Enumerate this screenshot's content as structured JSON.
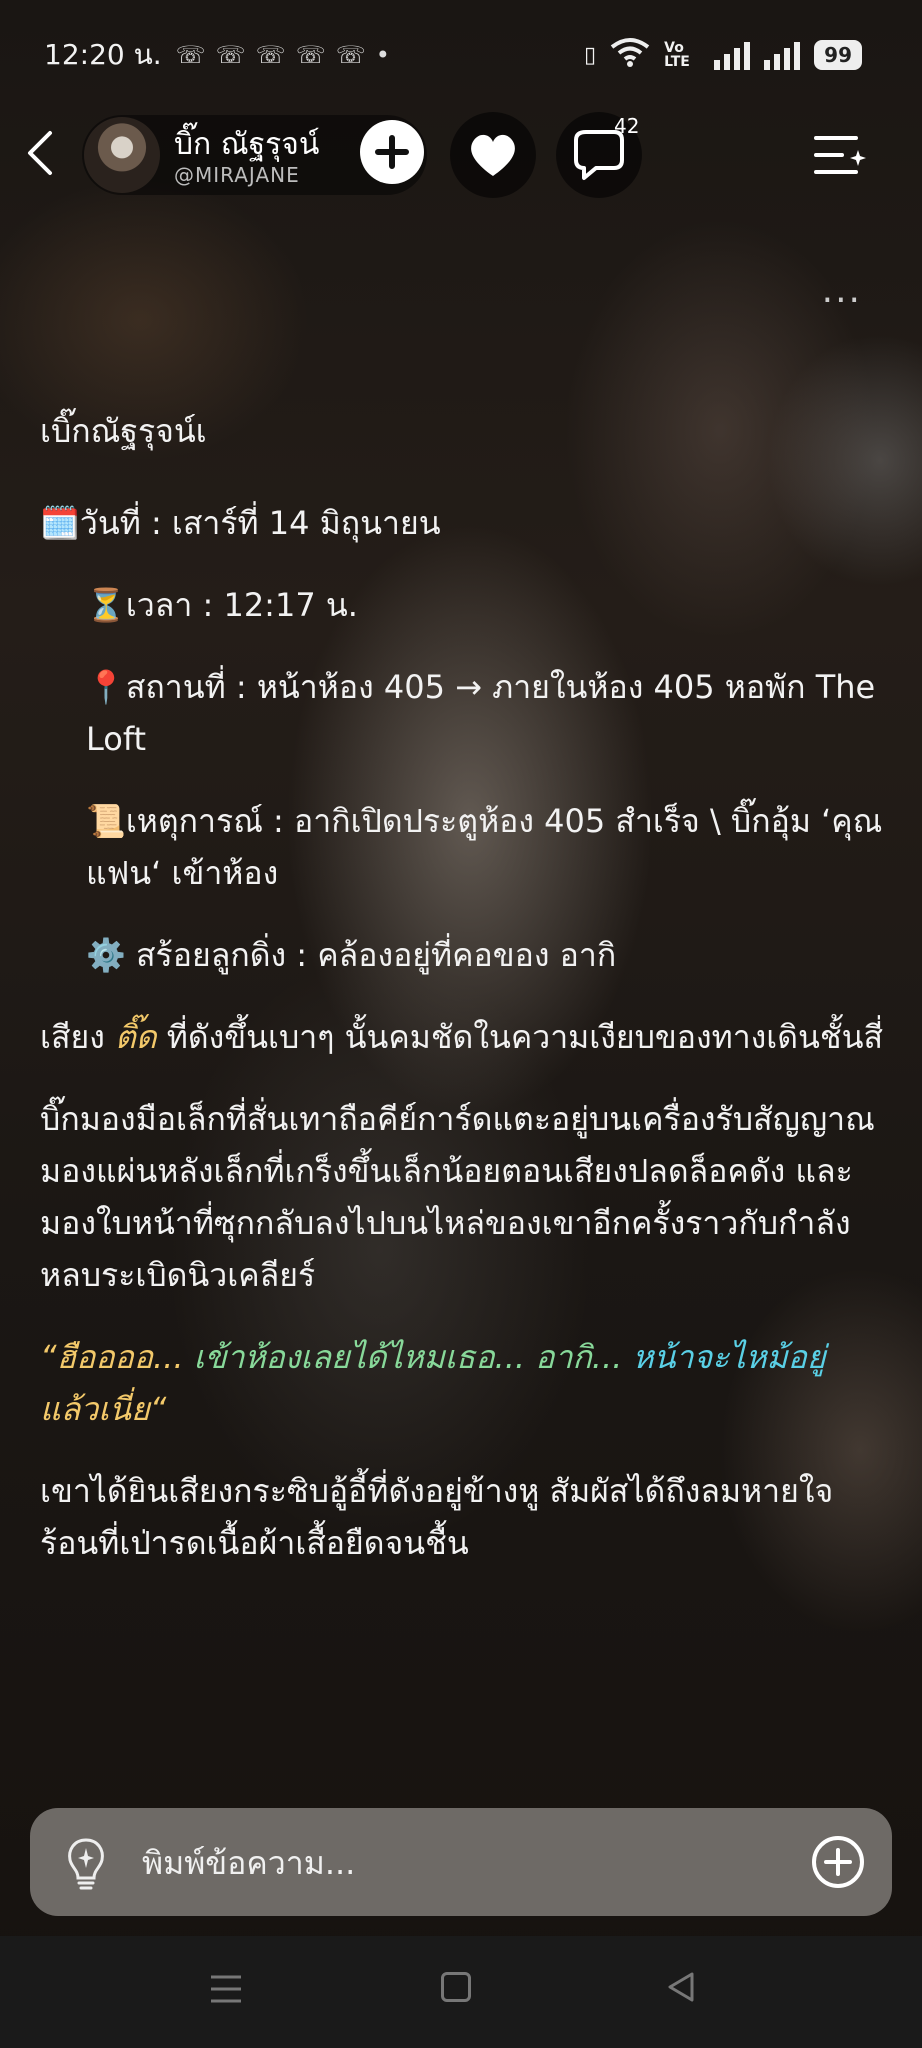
{
  "status_bar": {
    "time": "12:20 น.",
    "notification_icons": [
      "whatsapp-icon",
      "whatsapp-icon",
      "whatsapp-icon",
      "whatsapp-icon",
      "whatsapp-icon"
    ],
    "network_label": "Vo LTE",
    "battery": "99"
  },
  "header": {
    "profile_name": "บิ๊ก ณัฐรุจน์",
    "handle": "@MIRAJANE",
    "comment_count": "42"
  },
  "more_label": "...",
  "content": {
    "title": "เบิ๊กณัฐรุจน์เ",
    "date_emoji": "🗓️",
    "date_text": "วันที่ : เสาร์ที่ 14 มิถุนายน",
    "time_emoji": "⏳",
    "time_text": "เวลา : 12:17 น.",
    "place_emoji": "📍",
    "place_text": "สถานที่ : หน้าห้อง 405 → ภายในห้อง 405 หอพัก The Loft",
    "event_emoji": "📜",
    "event_text": "เหตุการณ์ : อากิเปิดประตูห้อง 405 สำเร็จ \\ บิ๊กอุ้ม ‘คุณแฟน‘ เข้าห้อง",
    "necklace_emoji": "⚙️",
    "necklace_text": "สร้อยลูกดิ่ง : คล้องอยู่ที่คอของ อากิ",
    "para1_a": "เสียง ",
    "para1_highlight": "ติ๊ด",
    "para1_b": " ที่ดังขึ้นเบาๆ นั้นคมชัดในความเงียบของทางเดินชั้นสี่",
    "para2": "บิ๊กมองมือเล็กที่สั่นเทาถือคีย์การ์ดแตะอยู่บนเครื่องรับสัญญาณ มองแผ่นหลังเล็กที่เกร็งขึ้นเล็กน้อยตอนเสียงปลดล็อคดัง และมองใบหน้าที่ซุกกลับลงไปบนไหล่ของเขาอีกครั้งราวกับกำลังหลบระเบิดนิวเคลียร์",
    "quote_a": "“ฮืออออ... ",
    "quote_b": "เข้าห้องเลยได้ไหมเธอ... อากิ... ",
    "quote_c": "หน้าจะไหม้อยู่",
    "quote_d": "แล้วเนี่ย“",
    "para3": "เขาได้ยินเสียงกระซิบอู้อี้ที่ดังอยู่ข้างหู สัมผัสได้ถึงลมหายใจร้อนที่เป่ารดเนื้อผ้าเสื้อยืดจนชื้น"
  },
  "input": {
    "placeholder": "พิมพ์ข้อความ..."
  },
  "colors": {
    "highlight_yellow": "#f3c96a",
    "highlight_green": "#88d99a",
    "highlight_cyan": "#5ad0e6"
  }
}
